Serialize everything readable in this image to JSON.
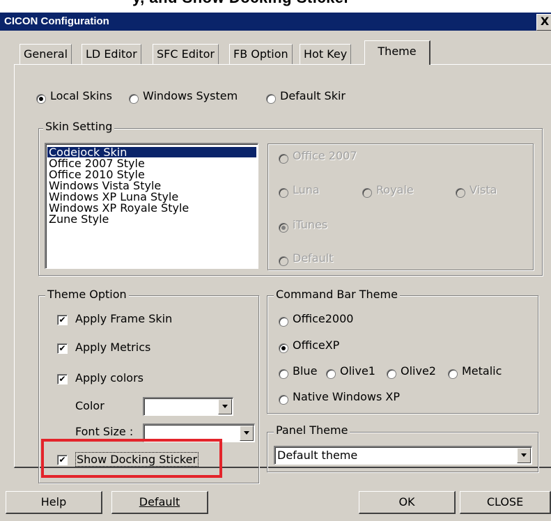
{
  "header_fragment": "y, and Show Docking Sticker",
  "window": {
    "title": "CICON Configuration",
    "close_label": "X"
  },
  "tabs": [
    {
      "label": "General"
    },
    {
      "label": "LD Editor"
    },
    {
      "label": "SFC Editor"
    },
    {
      "label": "FB Option"
    },
    {
      "label": "Hot Key"
    },
    {
      "label": "Theme",
      "active": true
    }
  ],
  "skin_source": {
    "options": [
      {
        "label": "Local Skins",
        "checked": true
      },
      {
        "label": "Windows System",
        "checked": false
      },
      {
        "label": "Default Skir",
        "checked": false
      }
    ]
  },
  "skin_setting": {
    "legend": "Skin Setting",
    "items": [
      "Codejock Skin",
      "Office 2007 Style",
      "Office 2010 Style",
      "Windows Vista Style",
      "Windows XP Luna Style",
      "Windows XP Royale Style",
      "Zune Style"
    ],
    "selected_index": 0,
    "styles": {
      "office2007": "Office 2007",
      "luna": "Luna",
      "royale": "Royale",
      "vista": "Vista",
      "itunes": "iTunes",
      "default": "Default",
      "selected": "iTunes"
    }
  },
  "theme_option": {
    "legend": "Theme Option",
    "apply_frame_skin": "Apply Frame Skin",
    "apply_metrics": "Apply Metrics",
    "apply_colors": "Apply colors",
    "color_label": "Color",
    "color_value": "",
    "font_size_label": "Font Size :",
    "font_size_value": "",
    "show_docking_sticker": "Show Docking Sticker",
    "check_mark": "✔"
  },
  "command_bar_theme": {
    "legend": "Command Bar Theme",
    "office2000": "Office2000",
    "officexp": "OfficeXP",
    "blue": "Blue",
    "olive1": "Olive1",
    "olive2": "Olive2",
    "metalic": "Metalic",
    "native_xp": "Native Windows XP",
    "selected": "OfficeXP"
  },
  "panel_theme": {
    "legend": "Panel Theme",
    "value": "Default theme"
  },
  "buttons": {
    "help": "Help",
    "default": "Default",
    "ok": "OK",
    "close": "CLOSE"
  },
  "colors": {
    "title_bar": "#0a246a",
    "dialog": "#d4d0c8",
    "highlight": "#e3242b"
  }
}
